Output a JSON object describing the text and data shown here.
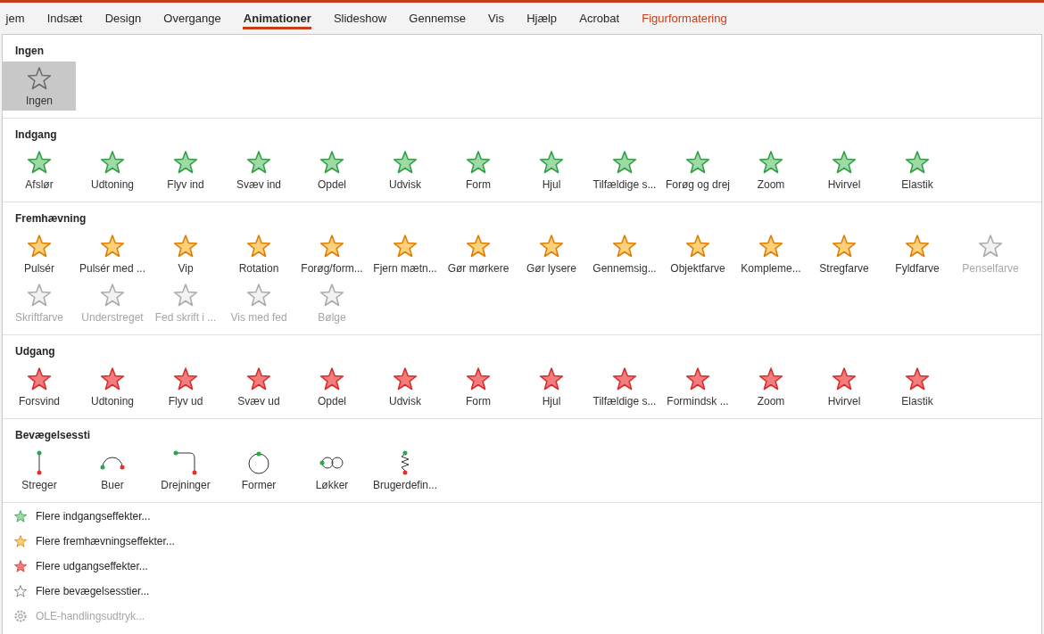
{
  "ribbon_tabs": [
    {
      "label": "jem",
      "selected": false,
      "kind": "normal"
    },
    {
      "label": "Indsæt",
      "selected": false,
      "kind": "normal"
    },
    {
      "label": "Design",
      "selected": false,
      "kind": "normal"
    },
    {
      "label": "Overgange",
      "selected": false,
      "kind": "normal"
    },
    {
      "label": "Animationer",
      "selected": true,
      "kind": "normal"
    },
    {
      "label": "Slideshow",
      "selected": false,
      "kind": "normal"
    },
    {
      "label": "Gennemse",
      "selected": false,
      "kind": "normal"
    },
    {
      "label": "Vis",
      "selected": false,
      "kind": "normal"
    },
    {
      "label": "Hjælp",
      "selected": false,
      "kind": "normal"
    },
    {
      "label": "Acrobat",
      "selected": false,
      "kind": "normal"
    },
    {
      "label": "Figurformatering",
      "selected": false,
      "kind": "contextual"
    }
  ],
  "gallery": {
    "sections": [
      {
        "title": "Ingen",
        "kind": "none",
        "items": [
          {
            "label": "Ingen",
            "selected": true,
            "disabled": false
          }
        ]
      },
      {
        "title": "Indgang",
        "kind": "entrance",
        "items": [
          {
            "label": "Afslør",
            "selected": false,
            "disabled": false
          },
          {
            "label": "Udtoning",
            "selected": false,
            "disabled": false
          },
          {
            "label": "Flyv ind",
            "selected": false,
            "disabled": false
          },
          {
            "label": "Svæv ind",
            "selected": false,
            "disabled": false
          },
          {
            "label": "Opdel",
            "selected": false,
            "disabled": false
          },
          {
            "label": "Udvisk",
            "selected": false,
            "disabled": false
          },
          {
            "label": "Form",
            "selected": false,
            "disabled": false
          },
          {
            "label": "Hjul",
            "selected": false,
            "disabled": false
          },
          {
            "label": "Tilfældige s...",
            "selected": false,
            "disabled": false
          },
          {
            "label": "Forøg og drej",
            "selected": false,
            "disabled": false
          },
          {
            "label": "Zoom",
            "selected": false,
            "disabled": false
          },
          {
            "label": "Hvirvel",
            "selected": false,
            "disabled": false
          },
          {
            "label": "Elastik",
            "selected": false,
            "disabled": false
          }
        ]
      },
      {
        "title": "Fremhævning",
        "kind": "emphasis",
        "items": [
          {
            "label": "Pulsér",
            "selected": false,
            "disabled": false
          },
          {
            "label": "Pulsér med ...",
            "selected": false,
            "disabled": false
          },
          {
            "label": "Vip",
            "selected": false,
            "disabled": false
          },
          {
            "label": "Rotation",
            "selected": false,
            "disabled": false
          },
          {
            "label": "Forøg/form...",
            "selected": false,
            "disabled": false
          },
          {
            "label": "Fjern mætn...",
            "selected": false,
            "disabled": false
          },
          {
            "label": "Gør mørkere",
            "selected": false,
            "disabled": false
          },
          {
            "label": "Gør lysere",
            "selected": false,
            "disabled": false
          },
          {
            "label": "Gennemsig...",
            "selected": false,
            "disabled": false
          },
          {
            "label": "Objektfarve",
            "selected": false,
            "disabled": false
          },
          {
            "label": "Kompleme...",
            "selected": false,
            "disabled": false
          },
          {
            "label": "Stregfarve",
            "selected": false,
            "disabled": false
          },
          {
            "label": "Fyldfarve",
            "selected": false,
            "disabled": false
          },
          {
            "label": "Penselfarve",
            "selected": false,
            "disabled": true
          },
          {
            "label": "Skriftfarve",
            "selected": false,
            "disabled": true
          },
          {
            "label": "Understreget",
            "selected": false,
            "disabled": true
          },
          {
            "label": "Fed skrift i ...",
            "selected": false,
            "disabled": true
          },
          {
            "label": "Vis med fed",
            "selected": false,
            "disabled": true
          },
          {
            "label": "Bølge",
            "selected": false,
            "disabled": true
          }
        ]
      },
      {
        "title": "Udgang",
        "kind": "exit",
        "items": [
          {
            "label": "Forsvind",
            "selected": false,
            "disabled": false
          },
          {
            "label": "Udtoning",
            "selected": false,
            "disabled": false
          },
          {
            "label": "Flyv ud",
            "selected": false,
            "disabled": false
          },
          {
            "label": "Svæv ud",
            "selected": false,
            "disabled": false
          },
          {
            "label": "Opdel",
            "selected": false,
            "disabled": false
          },
          {
            "label": "Udvisk",
            "selected": false,
            "disabled": false
          },
          {
            "label": "Form",
            "selected": false,
            "disabled": false
          },
          {
            "label": "Hjul",
            "selected": false,
            "disabled": false
          },
          {
            "label": "Tilfældige s...",
            "selected": false,
            "disabled": false
          },
          {
            "label": "Formindsk ...",
            "selected": false,
            "disabled": false
          },
          {
            "label": "Zoom",
            "selected": false,
            "disabled": false
          },
          {
            "label": "Hvirvel",
            "selected": false,
            "disabled": false
          },
          {
            "label": "Elastik",
            "selected": false,
            "disabled": false
          }
        ]
      },
      {
        "title": "Bevægelsessti",
        "kind": "motion",
        "items": [
          {
            "label": "Streger",
            "selected": false,
            "disabled": false,
            "kind": "line"
          },
          {
            "label": "Buer",
            "selected": false,
            "disabled": false,
            "kind": "arc"
          },
          {
            "label": "Drejninger",
            "selected": false,
            "disabled": false,
            "kind": "turn"
          },
          {
            "label": "Former",
            "selected": false,
            "disabled": false,
            "kind": "shape"
          },
          {
            "label": "Løkker",
            "selected": false,
            "disabled": false,
            "kind": "loop"
          },
          {
            "label": "Brugerdefin...",
            "selected": false,
            "disabled": false,
            "kind": "custom"
          }
        ]
      }
    ]
  },
  "more_links": [
    {
      "label": "Flere indgangseffekter...",
      "kind": "entrance",
      "disabled": false
    },
    {
      "label": "Flere fremhævningseffekter...",
      "kind": "emphasis",
      "disabled": false
    },
    {
      "label": "Flere udgangseffekter...",
      "kind": "exit",
      "disabled": false
    },
    {
      "label": "Flere bevægelsesstier...",
      "kind": "motion",
      "disabled": false
    },
    {
      "label": "OLE-handlingsudtryk...",
      "kind": "settings",
      "disabled": true
    }
  ]
}
